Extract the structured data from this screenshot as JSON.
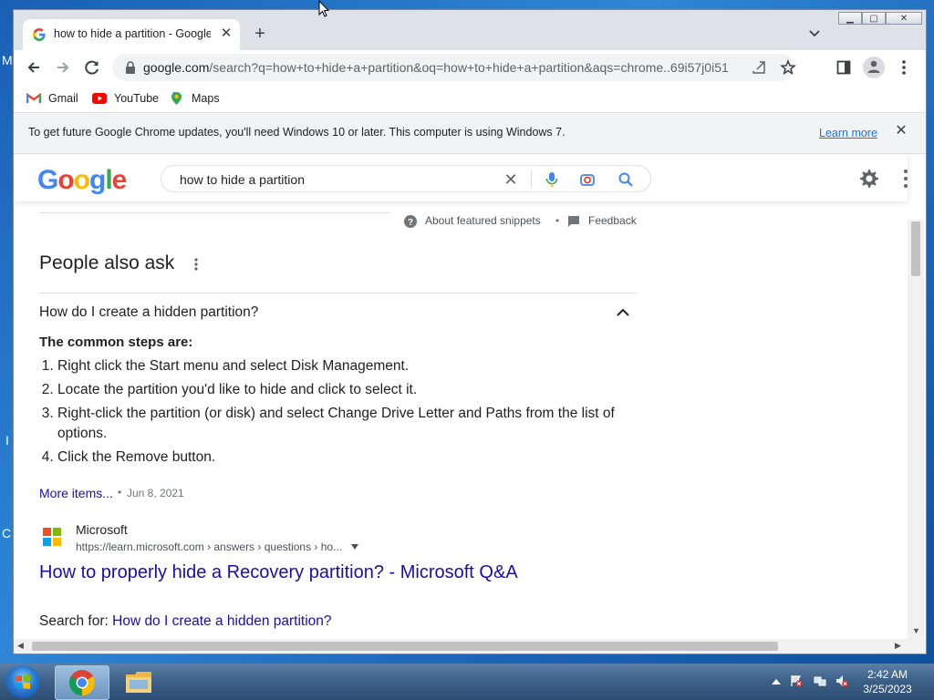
{
  "browser": {
    "tab_title": "how to hide a partition - Google",
    "url_host": "google.com",
    "url_rest": "/search?q=how+to+hide+a+partition&oq=how+to+hide+a+partition&aqs=chrome..69i57j0i51..."
  },
  "bookmarks": [
    {
      "label": "Gmail",
      "icon": "gmail-icon"
    },
    {
      "label": "YouTube",
      "icon": "youtube-icon"
    },
    {
      "label": "Maps",
      "icon": "maps-icon"
    }
  ],
  "infobar": {
    "text": "To get future Google Chrome updates, you'll need Windows 10 or later. This computer is using Windows 7.",
    "link": "Learn more"
  },
  "google": {
    "logo_letters": [
      "G",
      "o",
      "o",
      "g",
      "l",
      "e"
    ],
    "logo_colors": [
      "#4285f4",
      "#ea4335",
      "#fbbc05",
      "#4285f4",
      "#34a853",
      "#ea4335"
    ],
    "query": "how to hide a partition"
  },
  "snippet_footer": {
    "about": "About featured snippets",
    "feedback": "Feedback"
  },
  "paa": {
    "title": "People also ask",
    "question": "How do I create a hidden partition?",
    "answer_heading": "The common steps are:",
    "steps": [
      "Right click the Start menu and select Disk Management.",
      "Locate the partition you'd like to hide and click to select it.",
      "Right-click the partition (or disk) and select Change Drive Letter and Paths from the list of options.",
      "Click the Remove button."
    ],
    "more_items": "More items...",
    "date": "Jun 8, 2021",
    "source_name": "Microsoft",
    "source_url": "https://learn.microsoft.com › answers › questions › ho...",
    "result_title": "How to properly hide a Recovery partition? - Microsoft Q&A",
    "search_for_label": "Search for: ",
    "search_for_link": "How do I create a hidden partition?"
  },
  "taskbar": {
    "time": "2:42 AM",
    "date": "3/25/2023"
  },
  "desktop_letters": [
    "M",
    "I",
    "C"
  ]
}
